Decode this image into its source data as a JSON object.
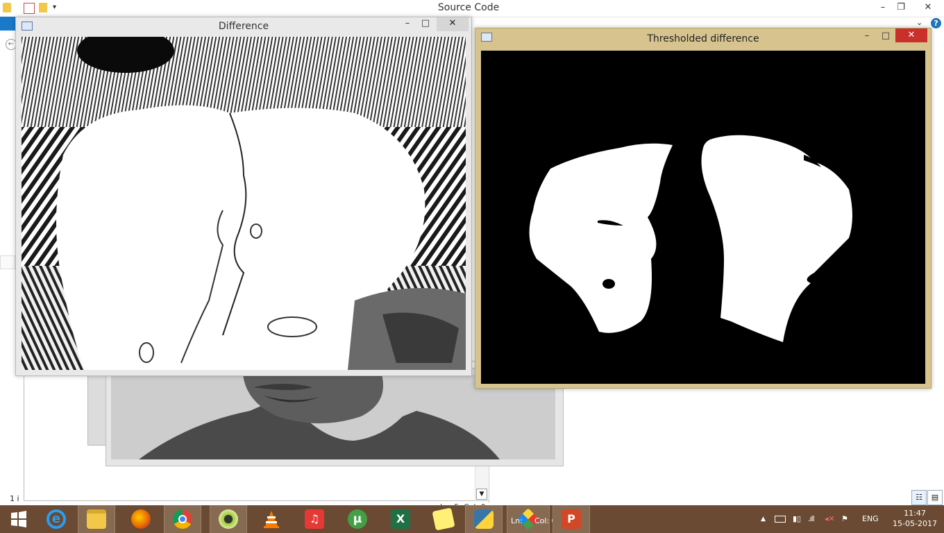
{
  "explorer": {
    "title": "Source Code",
    "minimize": "–",
    "restore": "❐",
    "close": "✕",
    "help": "?",
    "back": "←",
    "left_fragment": "1 i"
  },
  "editor": {
    "status_ln": "Ln: 5",
    "status_col": "Col: 0",
    "status_ln_2": "Ln:",
    "status_col_2": "Col: 0",
    "scroll_down": "▼"
  },
  "windows": {
    "difference": {
      "title": "Difference",
      "minimize": "–",
      "maximize": "□",
      "close": "✕"
    },
    "thresholded": {
      "title": "Thresholded difference",
      "minimize": "–",
      "maximize": "□",
      "close": "✕"
    }
  },
  "taskbar": {
    "apps": [
      {
        "name": "start",
        "icon": "windows-logo-icon",
        "color": "#ffffff"
      },
      {
        "name": "internet-explorer",
        "icon": "ie-icon",
        "color": "#2a9df4"
      },
      {
        "name": "file-explorer",
        "icon": "folder-icon",
        "color": "#f2c84b"
      },
      {
        "name": "firefox",
        "icon": "firefox-icon",
        "color": "#e66000"
      },
      {
        "name": "chrome",
        "icon": "chrome-icon",
        "color": "#4caf50"
      },
      {
        "name": "app-round",
        "icon": "circle-app-icon",
        "color": "#9acd32"
      },
      {
        "name": "vlc",
        "icon": "vlc-icon",
        "color": "#f57c00"
      },
      {
        "name": "music",
        "icon": "headphones-icon",
        "color": "#e53935"
      },
      {
        "name": "utorrent",
        "icon": "utorrent-icon",
        "color": "#43a047"
      },
      {
        "name": "excel",
        "icon": "excel-icon",
        "color": "#1e7145"
      },
      {
        "name": "sticky-notes",
        "icon": "notes-icon",
        "color": "#fff176"
      },
      {
        "name": "python",
        "icon": "python-icon",
        "color": "#3776ab"
      },
      {
        "name": "python-idle",
        "icon": "python-idle-icon",
        "color": "#e8e8e8"
      },
      {
        "name": "powerpoint",
        "icon": "powerpoint-icon",
        "color": "#d24726"
      }
    ],
    "tray": {
      "language": "ENG",
      "time": "11:47",
      "date": "15-05-2017",
      "up_arrow": "▲"
    }
  },
  "colors": {
    "taskbar": "#6a4a32",
    "thresholded_frame": "#d7c38e",
    "close_red": "#c9302c",
    "ribbon_blue": "#1979ca"
  }
}
